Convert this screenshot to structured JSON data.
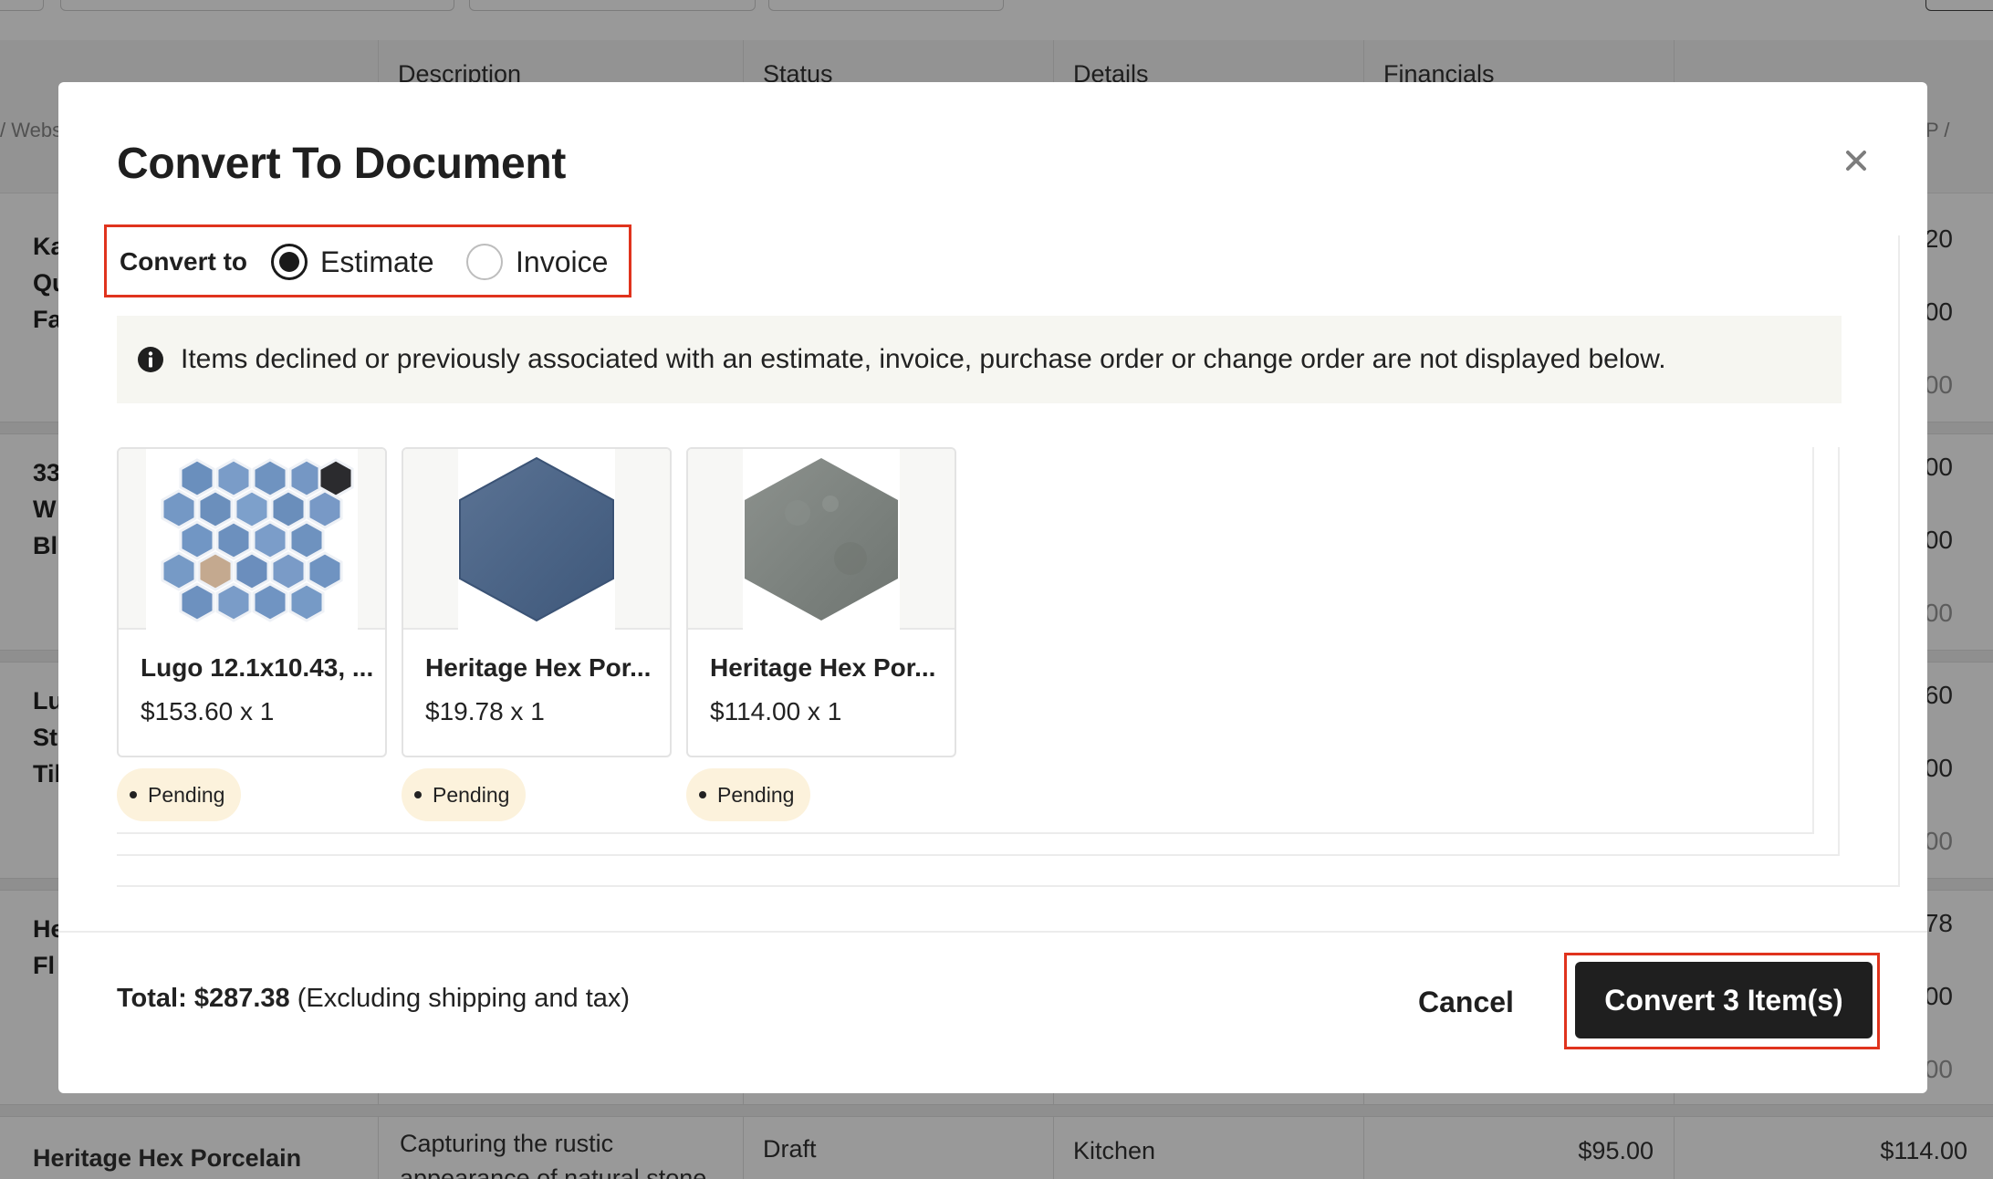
{
  "background": {
    "columns": [
      "Description",
      "Status",
      "Details",
      "Financials"
    ],
    "crumb_left": "/ Webs",
    "crumb_right": "P /",
    "row_labels": [
      [
        "Ka",
        "Qu",
        "Fa"
      ],
      [
        "33",
        "W",
        "Bl"
      ],
      [
        "Lu",
        "St",
        "Til"
      ],
      [
        "He",
        "Fl"
      ]
    ],
    "right_values": [
      ".20",
      ".00",
      ".00",
      ".00",
      ".00",
      ".00",
      ".60",
      ".00",
      ".00",
      ".78",
      ".00",
      ".00"
    ],
    "last_row": {
      "name": "Heritage Hex Porcelain",
      "description": "Capturing the rustic",
      "description_2": "appearance of natural stone",
      "status": "Draft",
      "details": "Kitchen",
      "cost": "$95.00",
      "total": "$114.00"
    }
  },
  "modal": {
    "title": "Convert To Document",
    "convert_to_label": "Convert to",
    "options": [
      {
        "label": "Estimate",
        "selected": true
      },
      {
        "label": "Invoice",
        "selected": false
      }
    ],
    "notice": "Items declined or previously associated with an estimate, invoice, purchase order or change order are not displayed below.",
    "items": [
      {
        "name": "Lugo 12.1x10.43, ...",
        "price": "$153.60 x 1",
        "status": "Pending",
        "thumb": "blue-hex-mosaic"
      },
      {
        "name": "Heritage Hex Por...",
        "price": "$19.78 x 1",
        "status": "Pending",
        "thumb": "blue-hex-tile"
      },
      {
        "name": "Heritage Hex Por...",
        "price": "$114.00 x 1",
        "status": "Pending",
        "thumb": "gray-hex-tile"
      }
    ],
    "total_label": "Total: $287.38",
    "total_note": "(Excluding shipping and tax)",
    "cancel_label": "Cancel",
    "convert_label": "Convert 3 Item(s)",
    "colors": {
      "accent_outline": "#e0331d",
      "primary_button": "#1f1f1f",
      "pending_pill": "#fcf2dc"
    }
  }
}
